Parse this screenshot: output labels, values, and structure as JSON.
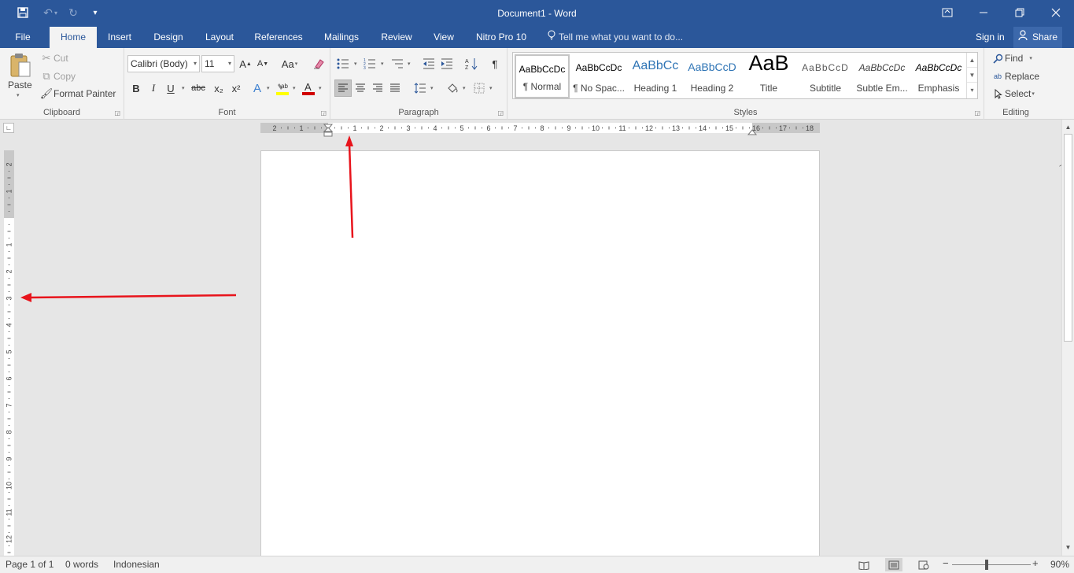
{
  "window": {
    "title": "Document1 - Word"
  },
  "quick_access": [
    {
      "name": "save-icon",
      "glyph": "🖫"
    },
    {
      "name": "undo-icon",
      "glyph": "↶"
    },
    {
      "name": "redo-icon",
      "glyph": "↻"
    },
    {
      "name": "customize-quick-access-icon",
      "glyph": "▾"
    }
  ],
  "tabs": [
    {
      "label": "File"
    },
    {
      "label": "Home"
    },
    {
      "label": "Insert"
    },
    {
      "label": "Design"
    },
    {
      "label": "Layout"
    },
    {
      "label": "References"
    },
    {
      "label": "Mailings"
    },
    {
      "label": "Review"
    },
    {
      "label": "View"
    },
    {
      "label": "Nitro Pro 10"
    }
  ],
  "tell_me": "Tell me what you want to do...",
  "sign_in": "Sign in",
  "share": "Share",
  "clipboard": {
    "label": "Clipboard",
    "paste": "Paste",
    "cut": "Cut",
    "copy": "Copy",
    "format_painter": "Format Painter"
  },
  "font": {
    "label": "Font",
    "family": "Calibri (Body)",
    "size": "11",
    "change_case": "Aa",
    "bold": "B",
    "italic": "I",
    "underline": "U",
    "strikethrough": "abc",
    "subscript": "x₂",
    "superscript": "x²"
  },
  "paragraph": {
    "label": "Paragraph",
    "show_marks": "¶"
  },
  "styles": {
    "label": "Styles",
    "items": [
      {
        "preview": "AaBbCcDc",
        "name": "¶ Normal"
      },
      {
        "preview": "AaBbCcDc",
        "name": "¶ No Spac..."
      },
      {
        "preview": "AaBbCc",
        "name": "Heading 1"
      },
      {
        "preview": "AaBbCcD",
        "name": "Heading 2"
      },
      {
        "preview": "AaB",
        "name": "Title"
      },
      {
        "preview": "AaBbCcD",
        "name": "Subtitle"
      },
      {
        "preview": "AaBbCcDc",
        "name": "Subtle Em..."
      },
      {
        "preview": "AaBbCcDc",
        "name": "Emphasis"
      }
    ]
  },
  "editing": {
    "label": "Editing",
    "find": "Find",
    "replace": "Replace",
    "select": "Select"
  },
  "ruler": {
    "h_labels": [
      "2",
      "1",
      "",
      "1",
      "2",
      "3",
      "4",
      "5",
      "6",
      "7",
      "8",
      "9",
      "10",
      "11",
      "12",
      "13",
      "14",
      "15",
      "16",
      "17",
      "18"
    ],
    "v_labels": [
      "2",
      "1",
      "",
      "1",
      "2",
      "3",
      "4",
      "5",
      "6",
      "7",
      "8",
      "9",
      "10",
      "11",
      "12"
    ]
  },
  "status": {
    "page": "Page 1 of 1",
    "words": "0 words",
    "language": "Indonesian",
    "zoom": "90%",
    "zoom_value": 90
  },
  "colors": {
    "accent": "#2b579a",
    "annotation_arrow": "#e8141c",
    "highlight": "#ffff00",
    "font_color": "#d00000"
  }
}
